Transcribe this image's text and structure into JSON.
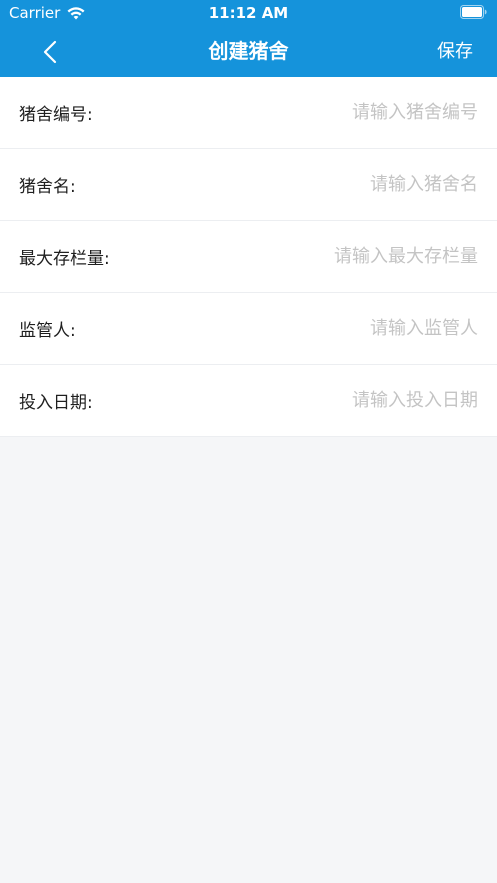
{
  "status_bar": {
    "carrier": "Carrier",
    "time": "11:12 AM"
  },
  "nav": {
    "title": "创建猪舍",
    "save_label": "保存",
    "back_icon": "chevron-left-icon"
  },
  "colors": {
    "header_bg": "#1593db",
    "page_bg": "#f5f6f8",
    "placeholder": "#c4c4c4",
    "label": "#1f1f1f"
  },
  "form": {
    "fields": [
      {
        "label": "猪舍编号:",
        "placeholder": "请输入猪舍编号",
        "value": ""
      },
      {
        "label": "猪舍名:",
        "placeholder": "请输入猪舍名",
        "value": ""
      },
      {
        "label": "最大存栏量:",
        "placeholder": "请输入最大存栏量",
        "value": ""
      },
      {
        "label": "监管人:",
        "placeholder": "请输入监管人",
        "value": ""
      },
      {
        "label": "投入日期:",
        "placeholder": "请输入投入日期",
        "value": ""
      }
    ]
  }
}
